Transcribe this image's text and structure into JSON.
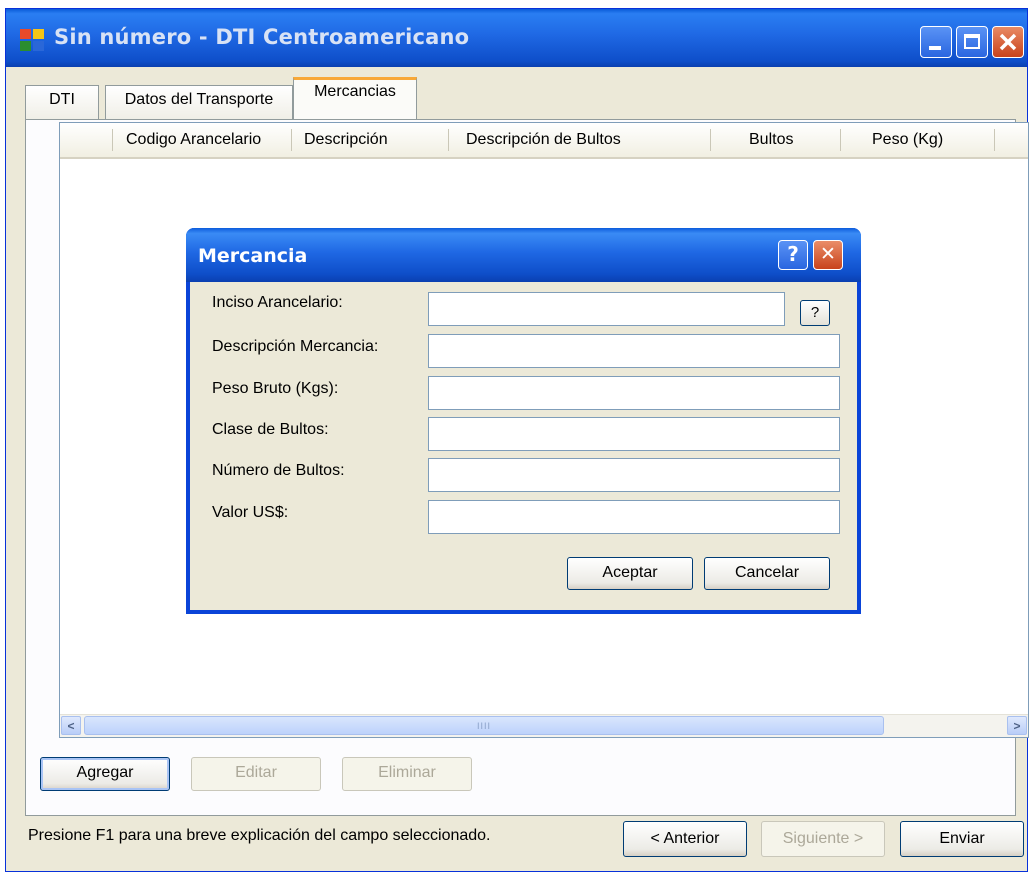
{
  "window": {
    "title": "Sin número - DTI Centroamericano"
  },
  "tabs": [
    {
      "label": "DTI"
    },
    {
      "label": "Datos del Transporte"
    },
    {
      "label": "Mercancias"
    }
  ],
  "grid": {
    "columns": [
      "Codigo Arancelario",
      "Descripción",
      "Descripción de Bultos",
      "Bultos",
      "Peso (Kg)"
    ],
    "rows": []
  },
  "grid_actions": {
    "add": "Agregar",
    "edit": "Editar",
    "delete": "Eliminar"
  },
  "status": {
    "hint": "Presione F1 para una breve explicación del campo seleccionado."
  },
  "nav": {
    "prev": "< Anterior",
    "next": "Siguiente >",
    "send": "Enviar"
  },
  "dialog": {
    "title": "Mercancia",
    "help_glyph": "?",
    "close_glyph": "✕",
    "lookup_glyph": "?",
    "fields": [
      {
        "label": "Inciso Arancelario:",
        "value": ""
      },
      {
        "label": "Descripción Mercancia:",
        "value": ""
      },
      {
        "label": "Peso Bruto (Kgs):",
        "value": ""
      },
      {
        "label": "Clase de Bultos:",
        "value": ""
      },
      {
        "label": "Número de Bultos:",
        "value": ""
      },
      {
        "label": "Valor US$:",
        "value": ""
      }
    ],
    "ok": "Aceptar",
    "cancel": "Cancelar"
  },
  "scroll": {
    "left_glyph": "<",
    "right_glyph": ">",
    "grip": "IIII"
  }
}
